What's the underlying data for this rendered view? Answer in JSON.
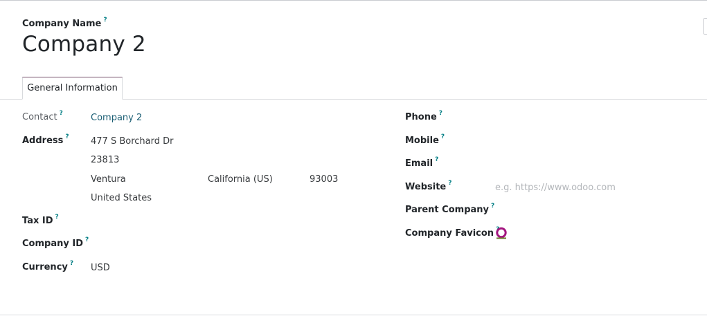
{
  "form": {
    "name_label": "Company Name",
    "help_mark": "?",
    "company_name": "Company 2"
  },
  "tabs": [
    {
      "label": "General Information"
    }
  ],
  "left": {
    "contact_label": "Contact",
    "contact_value": "Company 2",
    "address_label": "Address",
    "street": "477 S Borchard Dr",
    "street2": "23813",
    "city": "Ventura",
    "state": "California (US)",
    "zip": "93003",
    "country": "United States",
    "tax_id_label": "Tax ID",
    "company_id_label": "Company ID",
    "currency_label": "Currency",
    "currency_value": "USD"
  },
  "right": {
    "phone_label": "Phone",
    "mobile_label": "Mobile",
    "email_label": "Email",
    "website_label": "Website",
    "website_placeholder": "e.g. https://www.odoo.com",
    "parent_company_label": "Parent Company",
    "favicon_label": "Company Favicon",
    "favicon_icon": "odoo-circle-icon",
    "favicon_colors": {
      "ring": "#a3157f",
      "base": "#6b7a29"
    }
  }
}
